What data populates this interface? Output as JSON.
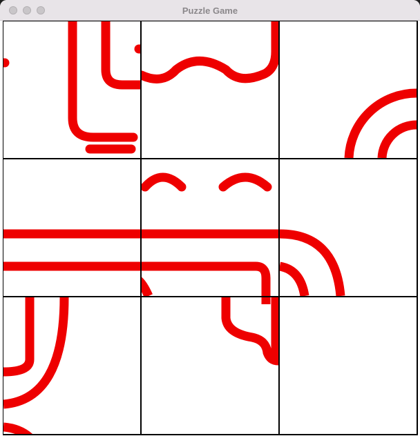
{
  "window": {
    "title": "Puzzle Game"
  },
  "colors": {
    "stroke": "#ee0000",
    "grid": "#000000",
    "tile_bg": "#ffffff",
    "titlebar": "#e8e4e8"
  },
  "board": {
    "rows": 3,
    "cols": 3,
    "empty_tile": "row-3-col-3"
  }
}
